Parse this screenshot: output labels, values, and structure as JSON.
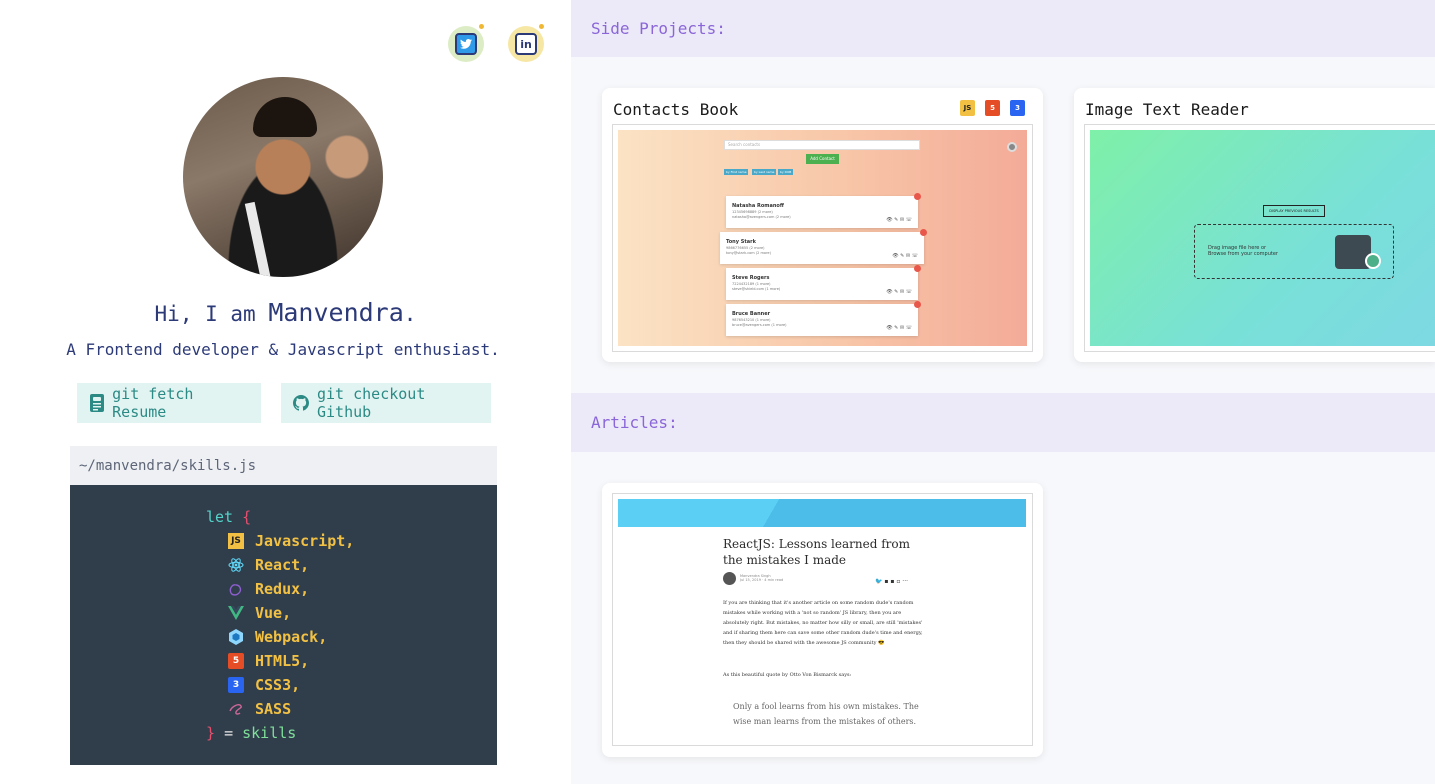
{
  "profile": {
    "greeting_prefix": "Hi, I am ",
    "name": "Manvendra",
    "greeting_suffix": ".",
    "tagline": "A Frontend developer & Javascript enthusiast.",
    "social": [
      {
        "icon": "twitter-icon"
      },
      {
        "icon": "linkedin-icon"
      }
    ]
  },
  "buttons": {
    "resume": "git fetch Resume",
    "github": "git checkout Github"
  },
  "code": {
    "filename": "~/manvendra/skills.js",
    "let": "let",
    "open_brace": "{",
    "close_brace": "}",
    "equals": "=",
    "var_name": "skills",
    "skills": [
      {
        "label": "Javascript,",
        "icon": "js-icon"
      },
      {
        "label": "React,",
        "icon": "react-icon"
      },
      {
        "label": "Redux,",
        "icon": "redux-icon"
      },
      {
        "label": "Vue,",
        "icon": "vue-icon"
      },
      {
        "label": "Webpack,",
        "icon": "webpack-icon"
      },
      {
        "label": "HTML5,",
        "icon": "html5-icon"
      },
      {
        "label": "CSS3,",
        "icon": "css3-icon"
      },
      {
        "label": "SASS",
        "icon": "sass-icon"
      }
    ]
  },
  "sections": {
    "side_projects": "Side Projects:",
    "articles": "Articles:"
  },
  "projects": [
    {
      "title": "Contacts Book",
      "tech": [
        "JS",
        "5",
        "3"
      ],
      "preview": {
        "search_placeholder": "Search contacts",
        "add_label": "Add Contact",
        "filters": [
          "by First name",
          "by Last name",
          "by DOB"
        ],
        "contacts": [
          {
            "name": "Natasha Romanoff",
            "line1": "12345698889 (2 more)",
            "line2": "natasha@avengers.com (2 more)"
          },
          {
            "name": "Tony Stark",
            "line1": "9866776655 (2 more)",
            "line2": "tony@stark.com (2 more)"
          },
          {
            "name": "Steve Rogers",
            "line1": "7224432189 (1 more)",
            "line2": "steve@shield.com (1 more)"
          },
          {
            "name": "Bruce Banner",
            "line1": "9876543210 (1 more)",
            "line2": "bruce@avengers.com (1 more)"
          }
        ]
      }
    },
    {
      "title": "Image Text Reader",
      "preview": {
        "button": "DISPLAY PREVIOUS RESULTS",
        "drop_line1": "Drag image file here or",
        "drop_line2": "Browse from your computer"
      }
    }
  ],
  "article": {
    "title": "ReactJS: Lessons learned from the mistakes I made",
    "author": "Manvendra Singh",
    "date": "Jul 15, 2019 · 4 min read",
    "para1": "If you are thinking that it's another article on some random dude's random mistakes while working with a 'not so random' JS library, then you are absolutely right. But mistakes, no matter how silly or small, are still 'mistakes' and if sharing them here can save some other random dude's time and energy, then they should be shared with the awesome JS community 😎",
    "para2": "As this beautiful quote by Otto Von Bismarck says:",
    "quote": "Only a fool learns from his own mistakes. The wise man learns from the mistakes of others."
  },
  "colors": {
    "navy": "#2c3a78",
    "teal": "#2c8a85",
    "purple": "#8a66d8",
    "code_bg": "#303e4b",
    "skill_yellow": "#f2c144"
  }
}
